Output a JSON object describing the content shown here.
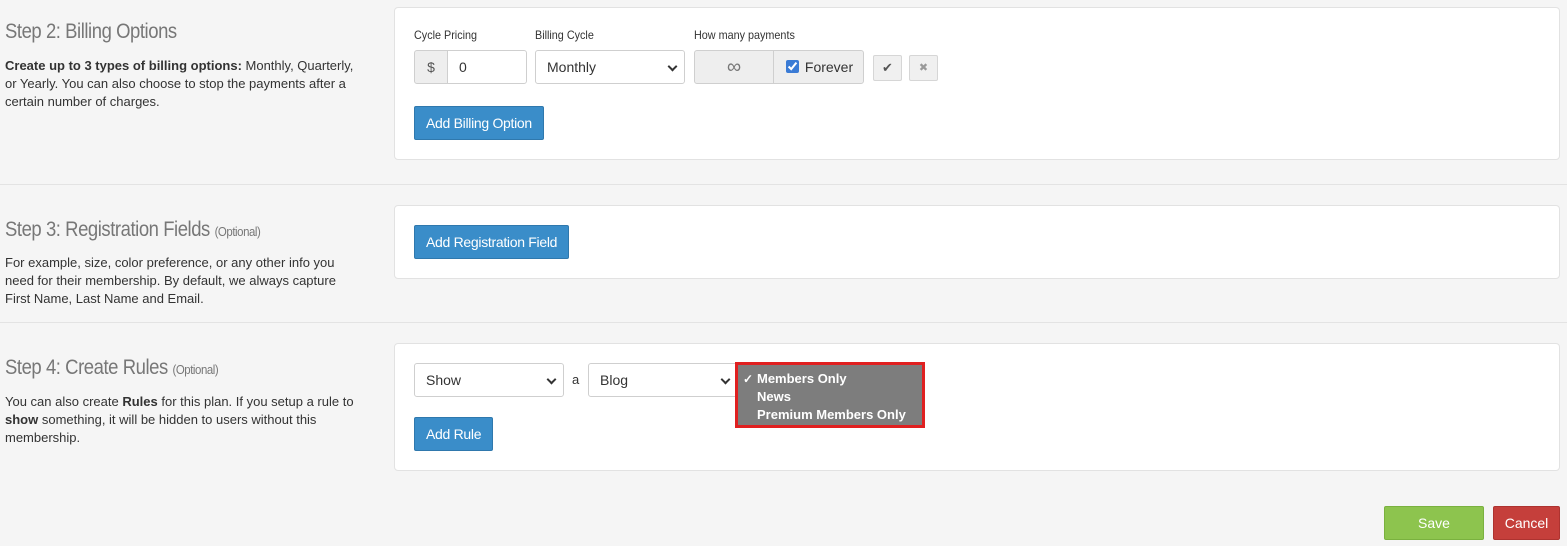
{
  "step2": {
    "title": "Step 2: Billing Options",
    "desc_bold": "Create up to 3 types of billing options:",
    "desc_rest": " Monthly, Quarterly, or Yearly. You can also choose to stop the payments after a certain number of charges.",
    "cycle_pricing_label": "Cycle Pricing",
    "billing_cycle_label": "Billing Cycle",
    "payments_label": "How many payments",
    "currency_symbol": "$",
    "price_value": "0",
    "billing_cycle_value": "Monthly",
    "infinity_symbol": "∞",
    "forever_label": "Forever",
    "forever_checked": true,
    "confirm_glyph": "✔",
    "remove_glyph": "✖",
    "add_button": "Add Billing Option"
  },
  "step3": {
    "title": "Step 3: Registration Fields",
    "optional": "(Optional)",
    "desc": "For example, size, color preference, or any other info you need for their membership. By default, we always capture First Name, Last Name and Email.",
    "add_button": "Add Registration Field"
  },
  "step4": {
    "title": "Step 4: Create Rules",
    "optional": "(Optional)",
    "desc_1": "You can also create ",
    "desc_bold_1": "Rules",
    "desc_2": " for this plan. If you setup a rule to ",
    "desc_bold_2": "show",
    "desc_3": " something, it will be hidden to users without this membership.",
    "action_select_value": "Show",
    "connector": "a",
    "type_select_value": "Blog",
    "dropdown_options": [
      "Members Only",
      "News",
      "Premium Members Only"
    ],
    "selected_option": "Members Only",
    "add_button": "Add Rule"
  },
  "footer": {
    "save_label": "Save",
    "cancel_label": "Cancel"
  },
  "colors": {
    "primary": "#3a8dc9",
    "save": "#8dc44e",
    "cancel": "#c53f3b",
    "highlight": "#e02020"
  }
}
